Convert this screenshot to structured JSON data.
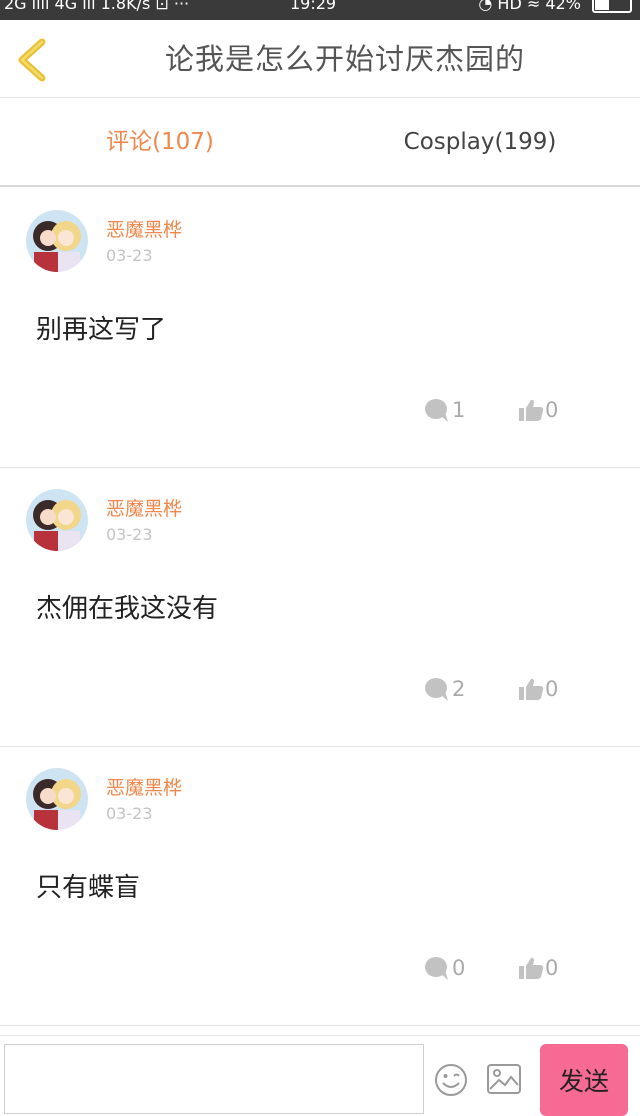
{
  "status_bar": {
    "left_text": "2G ııll 4G ıll 1.8K/s ⊡ ···",
    "time": "19:29",
    "right_text": "◔ HD ≈ 42%",
    "battery_percent": 42
  },
  "header": {
    "back_icon": "chevron-left-icon",
    "title": "论我是怎么开始讨厌杰园的"
  },
  "tabs": [
    {
      "label": "评论(107)",
      "active": true
    },
    {
      "label": "Cosplay(199)",
      "active": false
    }
  ],
  "comments": [
    {
      "username": "恶魔黑桦",
      "date": "03-23",
      "text": "别再这写了",
      "reply_count": "1",
      "like_count": "0"
    },
    {
      "username": "恶魔黑桦",
      "date": "03-23",
      "text": "杰佣在我这没有",
      "reply_count": "2",
      "like_count": "0"
    },
    {
      "username": "恶魔黑桦",
      "date": "03-23",
      "text": "只有蝶盲",
      "reply_count": "0",
      "like_count": "0"
    }
  ],
  "input_bar": {
    "placeholder": "",
    "send_label": "发送"
  },
  "colors": {
    "accent_orange": "#f0884d",
    "send_pink": "#f66a93",
    "back_yellow": "#e8c23a"
  }
}
